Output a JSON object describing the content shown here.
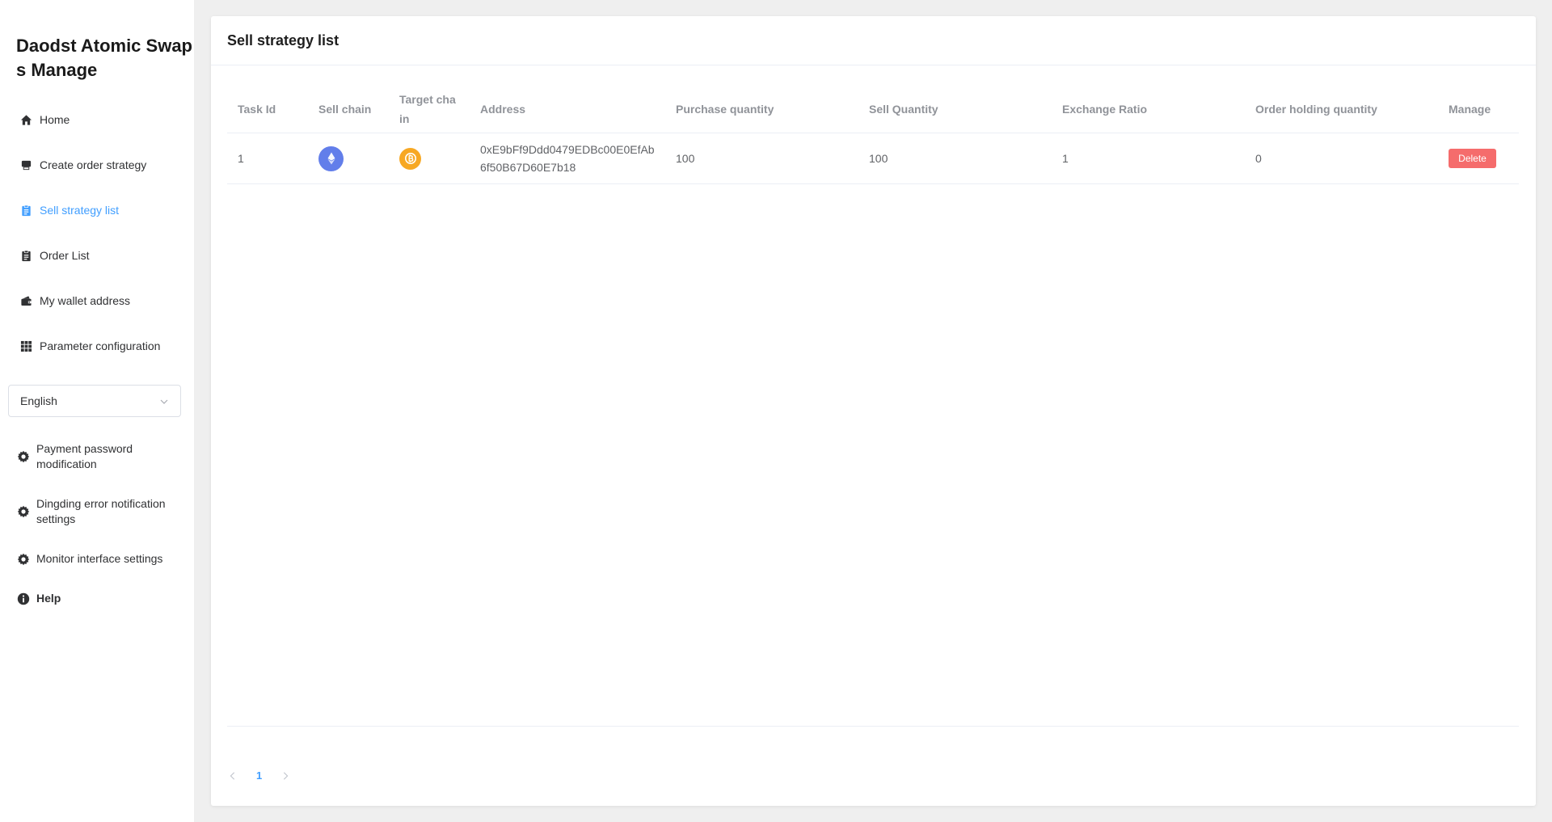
{
  "app": {
    "title": "Daodst Atomic Swaps Manage"
  },
  "sidebar": {
    "items": [
      {
        "label": "Home",
        "icon": "home-icon"
      },
      {
        "label": "Create order strategy",
        "icon": "printer-icon"
      },
      {
        "label": "Sell strategy list",
        "icon": "clipboard-icon",
        "active": true
      },
      {
        "label": "Order List",
        "icon": "clipboard-icon"
      },
      {
        "label": "My wallet address",
        "icon": "wallet-icon"
      },
      {
        "label": "Parameter configuration",
        "icon": "grid-icon"
      }
    ],
    "language": {
      "selected": "English"
    },
    "settings": [
      {
        "label": "Payment password modification",
        "icon": "gear-icon"
      },
      {
        "label": "Dingding error notification settings",
        "icon": "gear-icon"
      },
      {
        "label": "Monitor interface settings",
        "icon": "gear-icon"
      },
      {
        "label": "Help",
        "icon": "info-icon"
      }
    ]
  },
  "page": {
    "title": "Sell strategy list"
  },
  "table": {
    "columns": [
      "Task Id",
      "Sell chain",
      "Target chain",
      "Address",
      "Purchase quantity",
      "Sell Quantity",
      "Exchange Ratio",
      "Order holding quantity",
      "Manage"
    ],
    "rows": [
      {
        "task_id": "1",
        "sell_chain": "ethereum",
        "target_chain": "bitcoin",
        "address": "0xE9bFf9Ddd0479EDBc00E0EfAb6f50B67D60E7b18",
        "purchase_quantity": "100",
        "sell_quantity": "100",
        "exchange_ratio": "1",
        "order_holding_quantity": "0",
        "action": "Delete"
      }
    ]
  },
  "pagination": {
    "current_page": "1"
  },
  "colors": {
    "accent": "#409eff",
    "danger": "#f56c6c",
    "eth": "#627eea",
    "btc": "#f7a823"
  }
}
